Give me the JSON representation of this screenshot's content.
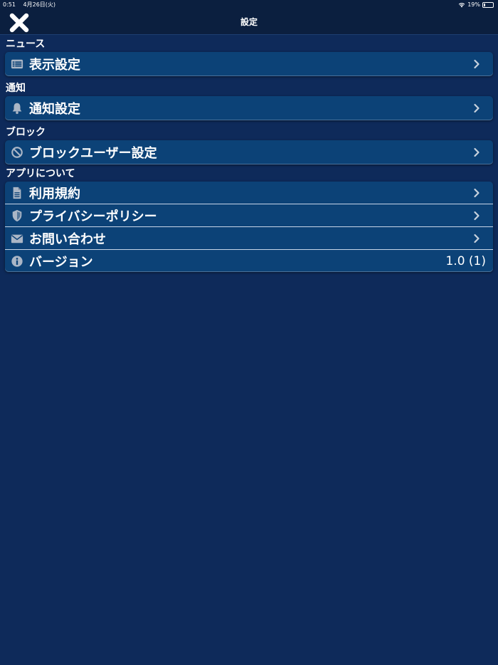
{
  "status_bar": {
    "time": "0:51",
    "date": "4月26日(火)",
    "battery": "19%",
    "battery_level": 0.19
  },
  "nav": {
    "title": "設定",
    "close_icon": "close-x-icon"
  },
  "sections": {
    "news": {
      "header": "ニュース",
      "items": [
        {
          "label": "表示設定",
          "icon": "list-icon"
        }
      ]
    },
    "notification": {
      "header": "通知",
      "items": [
        {
          "label": "通知設定",
          "icon": "bell-icon"
        }
      ]
    },
    "block": {
      "header": "ブロック",
      "items": [
        {
          "label": "ブロックユーザー設定",
          "icon": "prohibited-icon"
        }
      ]
    },
    "about": {
      "header": "アプリについて",
      "items": [
        {
          "label": "利用規約",
          "icon": "document-icon"
        },
        {
          "label": "プライバシーポリシー",
          "icon": "shield-icon"
        },
        {
          "label": "お問い合わせ",
          "icon": "envelope-icon"
        },
        {
          "label": "バージョン",
          "icon": "info-icon",
          "value": "1.0 (1)"
        }
      ]
    }
  },
  "colors": {
    "background": "#0e2a5a",
    "bar": "#0b1f3f",
    "row": "#0c4277",
    "icon": "#aab6c6"
  }
}
